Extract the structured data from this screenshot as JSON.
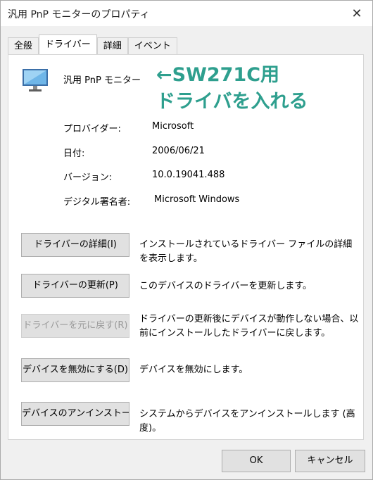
{
  "window": {
    "title": "汎用 PnP モニターのプロパティ",
    "close_glyph": "✕"
  },
  "tabs": [
    {
      "label": "全般",
      "active": false
    },
    {
      "label": "ドライバー",
      "active": true
    },
    {
      "label": "詳細",
      "active": false
    },
    {
      "label": "イベント",
      "active": false
    }
  ],
  "device": {
    "icon": "monitor-icon",
    "name": "汎用 PnP モニター"
  },
  "annotation": {
    "line1": "←SW271C用",
    "line2": "ドライバを入れる",
    "color": "#2e9f8e"
  },
  "info": [
    {
      "label": "プロバイダー:",
      "value": "Microsoft"
    },
    {
      "label": "日付:",
      "value": "2006/06/21"
    },
    {
      "label": "バージョン:",
      "value": "10.0.19041.488"
    },
    {
      "label": "デジタル署名者:",
      "value": "Microsoft Windows"
    }
  ],
  "actions": [
    {
      "button": "ドライバーの詳細(I)",
      "description": "インストールされているドライバー ファイルの詳細を表示します。",
      "enabled": true
    },
    {
      "button": "ドライバーの更新(P)",
      "description": "このデバイスのドライバーを更新します。",
      "enabled": true
    },
    {
      "button": "ドライバーを元に戻す(R)",
      "description": "ドライバーの更新後にデバイスが動作しない場合、以前にインストールしたドライバーに戻します。",
      "enabled": false
    },
    {
      "button": "デバイスを無効にする(D)",
      "description": "デバイスを無効にします。",
      "enabled": true
    },
    {
      "button": "デバイスのアンインストール(U)",
      "description": "システムからデバイスをアンインストールします (高度)。",
      "enabled": true
    }
  ],
  "footer": {
    "ok_label": "OK",
    "cancel_label": "キャンセル"
  }
}
